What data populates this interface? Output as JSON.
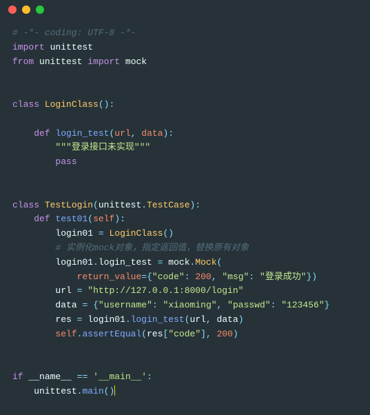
{
  "titlebar": {
    "buttons": [
      "close",
      "minimize",
      "maximize"
    ]
  },
  "code": {
    "l1_comment": "# -*- coding: UTF-8 -*-",
    "kw_import": "import",
    "kw_from": "from",
    "kw_class": "class",
    "kw_def": "def",
    "kw_pass": "pass",
    "kw_if": "if",
    "kw_return": "return_value",
    "mod_unittest": "unittest",
    "mod_mock": "mock",
    "cls_LoginClass": "LoginClass",
    "cls_TestLogin": "TestLogin",
    "cls_TestCase": "TestCase",
    "cls_Mock": "Mock",
    "fn_login_test": "login_test",
    "fn_test01": "test01",
    "fn_assertEqual": "assertEqual",
    "fn_main": "main",
    "p_url": "url",
    "p_data": "data",
    "p_self": "self",
    "v_login01": "login01",
    "v_res": "res",
    "docstring": "\"\"\"登录接口未实现\"\"\"",
    "comment_mock": "# 实例化mock对象，指定返回值，替换原有对象",
    "key_code": "\"code\"",
    "key_msg": "\"msg\"",
    "key_username": "\"username\"",
    "key_passwd": "\"passwd\"",
    "val_200": "200",
    "val_msg": "\"登录成功\"",
    "val_url": "\"http://127.0.0.1:8000/login\"",
    "val_username": "\"xiaoming\"",
    "val_passwd": "\"123456\"",
    "dunder_name": "__name__",
    "dunder_main": "'__main__'",
    "op_eq": "==",
    "op_assign": "=",
    "p_open": "(",
    "p_close": ")",
    "brace_open": "{",
    "brace_close": "}",
    "bracket_open": "[",
    "bracket_close": "]",
    "colon": ":",
    "comma": ",",
    "dot": "."
  }
}
